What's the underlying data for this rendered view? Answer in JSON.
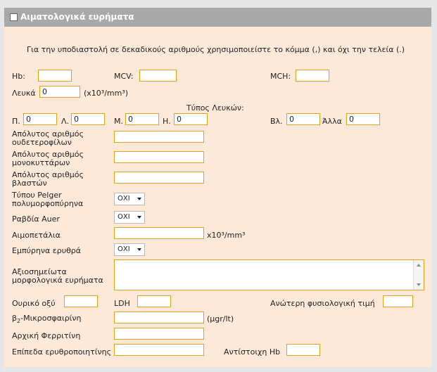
{
  "header": {
    "title": "Αιματολογικά ευρήματα"
  },
  "note": "Για την υποδιαστολή σε δεκαδικούς αριθμούς χρησιμοποιείστε το κόμμα (,) και όχι την τελεία (.)",
  "fields": {
    "hb": {
      "label": "Hb:",
      "value": ""
    },
    "mcv": {
      "label": "MCV:",
      "value": ""
    },
    "mch": {
      "label": "MCH:",
      "value": ""
    },
    "wbc": {
      "label": "Λευκά",
      "value": "0",
      "unit": "(x10³/mm³)"
    },
    "wbc_type": {
      "title": "Τύπος Λευκών:"
    },
    "p": {
      "label": "Π.",
      "value": "0"
    },
    "l": {
      "label": "Λ.",
      "value": "0"
    },
    "m": {
      "label": "Μ.",
      "value": "0"
    },
    "h": {
      "label": "Η.",
      "value": "0"
    },
    "vl": {
      "label": "Βλ.",
      "value": "0"
    },
    "other": {
      "label": "Άλλα",
      "value": "0"
    },
    "abs_neutro": {
      "label": "Απόλυτος αριθμός ουδετεροφίλων",
      "value": ""
    },
    "abs_mono": {
      "label": "Απόλυτος αριθμός μονοκυττάρων",
      "value": ""
    },
    "abs_blasts": {
      "label": "Απόλυτος αριθμός βλαστών",
      "value": ""
    },
    "pelger": {
      "label": "Τύπου Pelger πολυμορφοπύρηνα",
      "selected": "ΟΧΙ"
    },
    "auer": {
      "label": "Ραβδία Auer",
      "selected": "ΟΧΙ"
    },
    "plt": {
      "label": "Αιμοπετάλια",
      "value": "",
      "unit": "x10³/mm³"
    },
    "nrbc": {
      "label": "Εμπύρηνα ερυθρά",
      "selected": "ΟΧΙ"
    },
    "morph": {
      "label": "Αξιοσημείωτα μορφολογικά ευρήματα",
      "value": ""
    },
    "uric": {
      "label": "Ουρικό οξύ",
      "value": ""
    },
    "ldh": {
      "label": "LDH",
      "value": ""
    },
    "upper_norm": {
      "label": "Ανώτερη φυσιολογική τιμή",
      "value": ""
    },
    "b2m": {
      "label_main": "β",
      "label_sub": "2",
      "label_rest": "-Μικροσφαιρίνη",
      "value": "",
      "unit": "(μgr/lt)"
    },
    "ferritin": {
      "label": "Αρχική Φερριτίνη",
      "value": ""
    },
    "epo": {
      "label": "Επίπεδα ερυθροποιητίνης",
      "value": ""
    },
    "hb_corr": {
      "label": "Αντίστοιχη Hb",
      "value": ""
    }
  }
}
